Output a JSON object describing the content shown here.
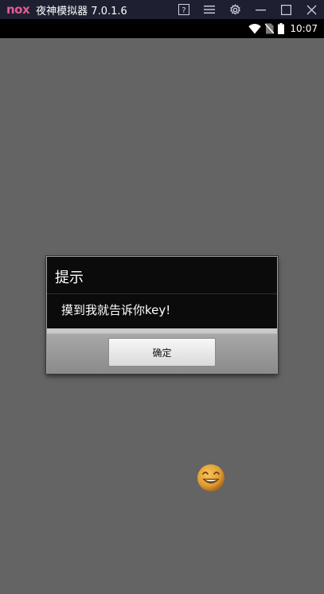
{
  "titlebar": {
    "logo_text": "nox",
    "app_title": "夜神模拟器 7.0.1.6",
    "icons": [
      "help-icon",
      "menu-icon",
      "settings-icon",
      "minimize-icon",
      "maximize-icon",
      "close-icon"
    ]
  },
  "statusbar": {
    "time": "10:07",
    "icons": [
      "wifi-icon",
      "no-sim-icon",
      "battery-icon"
    ]
  },
  "dialog": {
    "title": "提示",
    "message": "摸到我就告诉你key!",
    "button_label": "确定"
  },
  "screen": {
    "background_color": "#646464",
    "sprite": "smiley-face-icon"
  },
  "colors": {
    "titlebar_bg": "#1e2032",
    "logo_accent": "#e35b8f",
    "dialog_bg": "#0b0b0b",
    "smiley_fill": "#e8a23a"
  }
}
